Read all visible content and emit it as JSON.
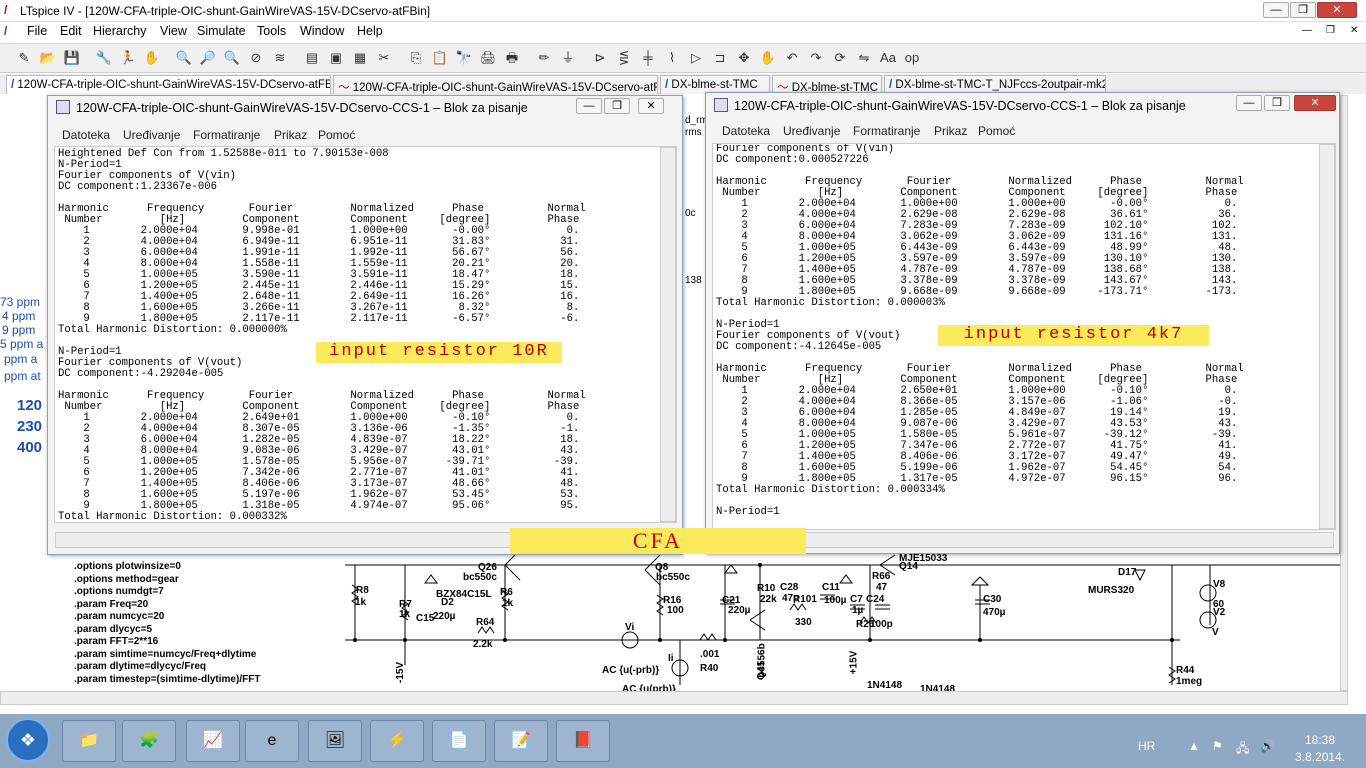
{
  "app": {
    "title": "LTspice IV - [120W-CFA-triple-OIC-shunt-GainWireVAS-15V-DCservo-atFBin]",
    "logo": "/",
    "window_buttons": {
      "minimize": "—",
      "restore": "❐",
      "close": "✕"
    }
  },
  "menu": [
    "File",
    "Edit",
    "Hierarchy",
    "View",
    "Simulate",
    "Tools",
    "Window",
    "Help"
  ],
  "mdi_buttons": [
    "—",
    "❐",
    "✕"
  ],
  "toolbar_icons": [
    "new-schematic-icon",
    "open-icon",
    "save-icon",
    "control-panel-icon",
    "run-icon",
    "halt-icon",
    "zoom-in-icon",
    "zoom-pan-icon",
    "zoom-out-icon",
    "zoom-fit-icon",
    "autorange-icon",
    "grid-icon",
    "tile-icon",
    "cascade-icon",
    "close-all-icon",
    "cut-icon",
    "copy-icon",
    "paste-icon",
    "find-icon",
    "print-icon",
    "print-preview-icon",
    "wire-icon",
    "ground-icon",
    "label-icon",
    "resistor-icon",
    "capacitor-icon",
    "inductor-icon",
    "diode-icon",
    "component-icon",
    "move-icon",
    "drag-icon",
    "undo-icon",
    "redo-icon",
    "rotate-icon",
    "mirror-icon",
    "text-icon",
    "spice-directive-icon"
  ],
  "toolbar_glyphs": [
    "✎",
    "📂",
    "💾",
    "🔧",
    "🏃",
    "✋",
    "🔍",
    "🔎",
    "🔍",
    "⊘",
    "≋",
    "▤",
    "▣",
    "▦",
    "✂",
    "⎘",
    "📋",
    "🔭",
    "🖨",
    "🖶",
    "✏",
    "⏚",
    "⊳",
    "⋚",
    "╪",
    "⌇",
    "▷",
    "⊐",
    "✥",
    "✋",
    "↶",
    "↷",
    "⟳",
    "⇋",
    "Aa",
    "op"
  ],
  "tabs": [
    "120W-CFA-triple-OIC-shunt-GainWireVAS-15V-DCservo-atFBin",
    "120W-CFA-triple-OIC-shunt-GainWireVAS-15V-DCservo-atFBin",
    "DX-blme-st-TMC",
    "DX-blme-st-TMC",
    "DX-blme-st-TMC-T_NJFccs-2outpair-mk2"
  ],
  "schematic": {
    "left_text": [
      "73 ppm",
      "4 ppm",
      "9 ppm",
      "5 ppm a",
      "ppm a",
      "ppm at"
    ],
    "left_blue": [
      "120",
      "230",
      "400"
    ],
    "directives": [
      ".options plotwinsize=0",
      ".options method=gear",
      ".options numdgt=7",
      ".param Freq=20",
      ".param numcyc=20",
      ".param dlycyc=5",
      ".param FFT=2**16",
      ".param simtime=numcyc/Freq+dlytime",
      ".param dlytime=dlycyc/Freq",
      ".param timestep=(simtime-dlytime)/FFT"
    ],
    "fragment_labels": [
      "0c",
      "138",
      "d_rm",
      "rms"
    ],
    "components": [
      {
        "t": "R8"
      },
      {
        "t": "1k"
      },
      {
        "t": "R7"
      },
      {
        "t": "1k"
      },
      {
        "t": "Q26"
      },
      {
        "t": "bc550c"
      },
      {
        "t": "BZX84C15L"
      },
      {
        "t": "D2"
      },
      {
        "t": "C15"
      },
      {
        "t": "220µ"
      },
      {
        "t": "R6"
      },
      {
        "t": "1k"
      },
      {
        "t": "R64"
      },
      {
        "t": "2.2k"
      },
      {
        "t": "Q8"
      },
      {
        "t": "bc550c"
      },
      {
        "t": "R16"
      },
      {
        "t": "100"
      },
      {
        "t": "Vi"
      },
      {
        "t": "Ii"
      },
      {
        "t": "R40"
      },
      {
        "t": ".001"
      },
      {
        "t": "AC {u(-prb)}"
      },
      {
        "t": "AC {u(prb)}"
      },
      {
        "t": "C21"
      },
      {
        "t": "220µ"
      },
      {
        "t": "R10"
      },
      {
        "t": "22k"
      },
      {
        "t": "C28"
      },
      {
        "t": "47p"
      },
      {
        "t": "R101"
      },
      {
        "t": "330"
      },
      {
        "t": "C11"
      },
      {
        "t": "100µ"
      },
      {
        "t": "Q41"
      },
      {
        "t": "bc556b"
      },
      {
        "t": "C7"
      },
      {
        "t": "1µ"
      },
      {
        "t": "C24"
      },
      {
        "t": "100p"
      },
      {
        "t": "R66"
      },
      {
        "t": "47"
      },
      {
        "t": "R26"
      },
      {
        "t": "Q14"
      },
      {
        "t": "MJE15033"
      },
      {
        "t": "C30"
      },
      {
        "t": "470µ"
      },
      {
        "t": "D17"
      },
      {
        "t": "MURS320"
      },
      {
        "t": "V8"
      },
      {
        "t": "60"
      },
      {
        "t": "V2"
      },
      {
        "t": "V"
      },
      {
        "t": "R44"
      },
      {
        "t": "1meg"
      },
      {
        "t": "-15V"
      },
      {
        "t": "+15V"
      },
      {
        "t": "1N4148"
      },
      {
        "t": "1N4148"
      }
    ]
  },
  "notepad1": {
    "title": "120W-CFA-triple-OIC-shunt-GainWireVAS-15V-DCservo-CCS-1 – Blok za pisanje",
    "menu": [
      "Datoteka",
      "Uređivanje",
      "Formatiranje",
      "Prikaz",
      "Pomoć"
    ],
    "content": "Heightened Def Con from 1.52588e-011 to 7.90153e-008\nN-Period=1\nFourier components of V(vin)\nDC component:1.23367e-006\n\nHarmonic      Frequency       Fourier         Normalized      Phase          Normal\n Number         [Hz]         Component        Component     [degree]         Phase\n    1        2.000e+04       9.998e-01        1.000e+00       -0.00°            0.\n    2        4.000e+04       6.949e-11        6.951e-11       31.83°           31.\n    3        6.000e+04       1.991e-11        1.992e-11       56.67°           56.\n    4        8.000e+04       1.558e-11        1.559e-11       20.21°           20.\n    5        1.000e+05       3.590e-11        3.591e-11       18.47°           18.\n    6        1.200e+05       2.445e-11        2.446e-11       15.29°           15.\n    7        1.400e+05       2.648e-11        2.649e-11       16.26°           16.\n    8        1.600e+05       3.266e-11        3.267e-11        8.32°            8.\n    9        1.800e+05       2.117e-11        2.117e-11       -6.57°           -6.\nTotal Harmonic Distortion: 0.000000%\n\nN-Period=1\nFourier components of V(vout)\nDC component:-4.29204e-005\n\nHarmonic      Frequency       Fourier         Normalized      Phase          Normal\n Number         [Hz]         Component        Component     [degree]         Phase\n    1        2.000e+04       2.649e+01        1.000e+00       -0.10°            0.\n    2        4.000e+04       8.307e-05        3.136e-06       -1.35°           -1.\n    3        6.000e+04       1.282e-05        4.839e-07       18.22°           18.\n    4        8.000e+04       9.083e-06        3.429e-07       43.01°           43.\n    5        1.000e+05       1.578e-05        5.956e-07      -39.71°          -39.\n    6        1.200e+05       7.342e-06        2.771e-07       41.01°           41.\n    7        1.400e+05       8.406e-06        3.173e-07       48.66°           48.\n    8        1.600e+05       5.197e-06        1.962e-07       53.45°           53.\n    9        1.800e+05       1.318e-05        4.974e-07       95.06°           95.\nTotal Harmonic Distortion: 0.000332%",
    "annotation": "input resistor 10R"
  },
  "notepad2": {
    "title": "120W-CFA-triple-OIC-shunt-GainWireVAS-15V-DCservo-CCS-1 – Blok za pisanje",
    "menu": [
      "Datoteka",
      "Uređivanje",
      "Formatiranje",
      "Prikaz",
      "Pomoć"
    ],
    "content": "Fourier components of V(vin)\nDC component:0.000527226\n\nHarmonic      Frequency       Fourier         Normalized      Phase          Normal\n Number         [Hz]         Component        Component     [degree]         Phase\n    1        2.000e+04       1.000e+00        1.000e+00       -0.00°            0.\n    2        4.000e+04       2.629e-08        2.629e-08       36.61°           36.\n    3        6.000e+04       7.283e-09        7.283e-09      102.10°          102.\n    4        8.000e+04       3.062e-09        3.062e-09      131.16°          131.\n    5        1.000e+05       6.443e-09        6.443e-09       48.99°           48.\n    6        1.200e+05       3.597e-09        3.597e-09      130.10°          130.\n    7        1.400e+05       4.787e-09        4.787e-09      138.68°          138.\n    8        1.600e+05       3.378e-09        3.378e-09      143.67°          143.\n    9        1.800e+05       9.668e-09        9.668e-09     -173.71°         -173.\nTotal Harmonic Distortion: 0.000003%\n\nN-Period=1\nFourier components of V(vout)\nDC component:-4.12645e-005\n\nHarmonic      Frequency       Fourier         Normalized      Phase          Normal\n Number         [Hz]         Component        Component     [degree]         Phase\n    1        2.000e+04       2.650e+01        1.000e+00       -0.10°            0.\n    2        4.000e+04       8.366e-05        3.157e-06       -1.06°           -0.\n    3        6.000e+04       1.285e-05        4.849e-07       19.14°           19.\n    4        8.000e+04       9.087e-06        3.429e-07       43.53°           43.\n    5        1.000e+05       1.580e-05        5.961e-07      -39.12°          -39.\n    6        1.200e+05       7.347e-06        2.772e-07       41.75°           41.\n    7        1.400e+05       8.406e-06        3.172e-07       49.47°           49.\n    8        1.600e+05       5.199e-06        1.962e-07       54.45°           54.\n    9        1.800e+05       1.317e-05        4.972e-07       96.15°           96.\nTotal Harmonic Distortion: 0.000334%\n\nN-Period=1",
    "annotation": "input resistor 4k7"
  },
  "cfa_label": "CFA",
  "taskbar": {
    "start": "❖",
    "apps": [
      "📁",
      "🧩",
      "📈",
      "e",
      "🖼",
      "⚡",
      "📄",
      "📝",
      "📕"
    ],
    "lang": "HR",
    "time": "18:38",
    "date": "3.8.2014.",
    "tray_icons": [
      "▲",
      "⚑",
      "🖧",
      "🔊"
    ]
  },
  "colors": {
    "highlight_bg": "#fbea5c",
    "highlight_text": "#b00000",
    "blue_text": "#1a4fb0"
  }
}
